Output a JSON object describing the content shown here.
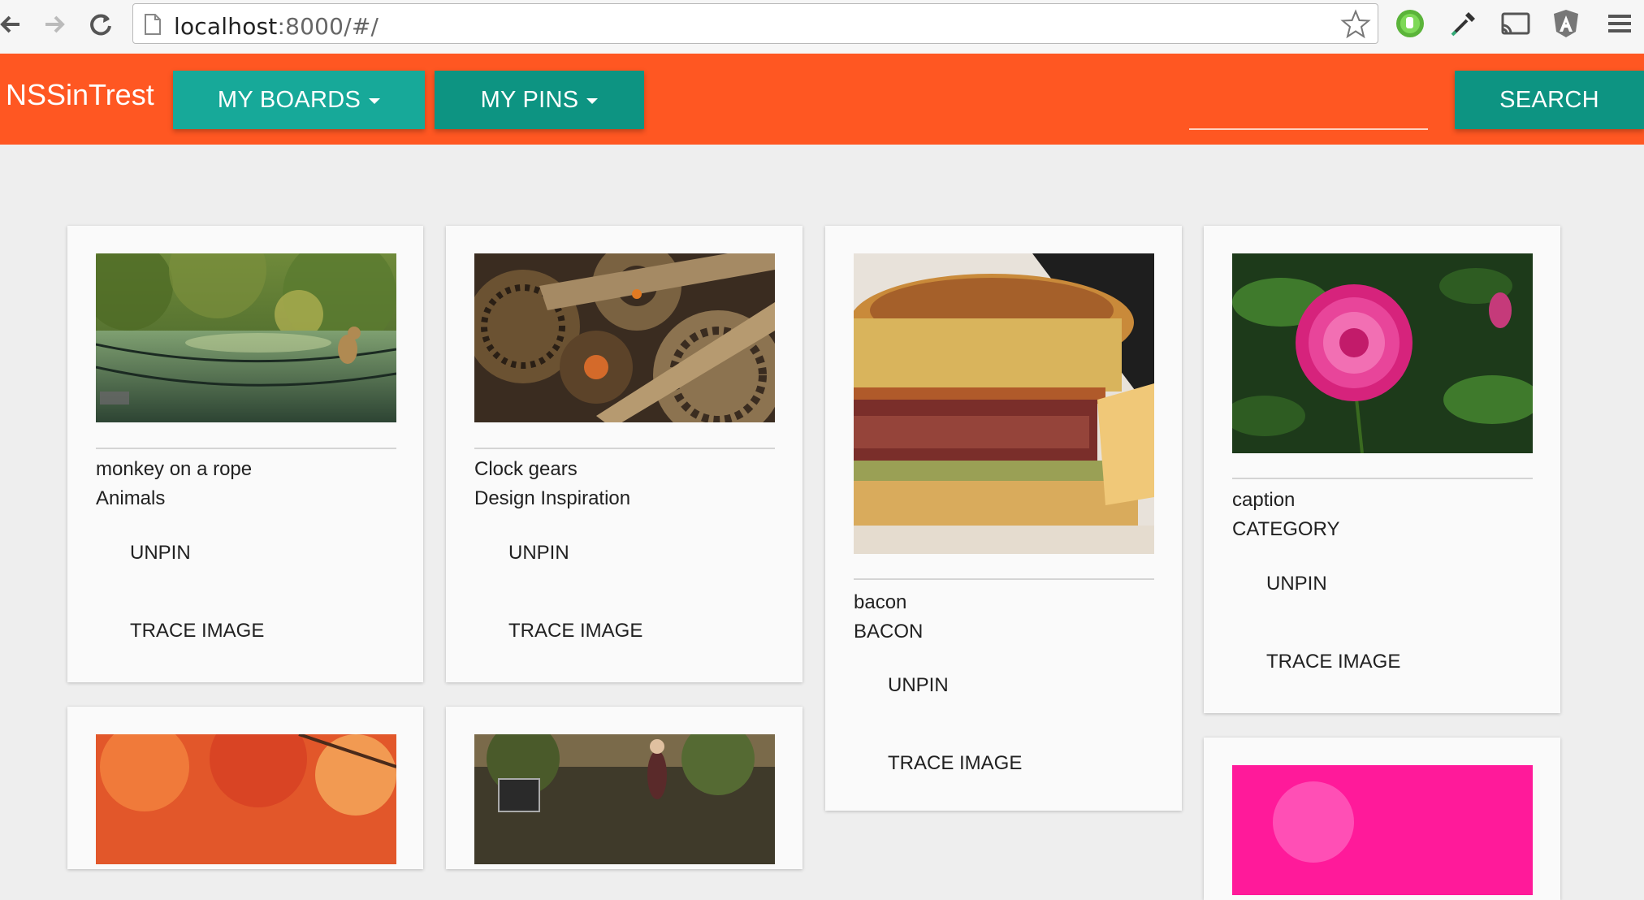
{
  "browser": {
    "url_host": "localhost",
    "url_rest": ":8000/#/"
  },
  "navbar": {
    "brand": "NSSinTrest",
    "my_boards": "MY BOARDS",
    "my_pins": "MY PINS",
    "search": "SEARCH",
    "search_value": ""
  },
  "colors": {
    "navbar": "#ff5722",
    "button_light": "#17a999",
    "button_dark": "#0d9482"
  },
  "cards": [
    {
      "caption": "monkey on a rope",
      "category": "Animals",
      "unpin": "UNPIN",
      "trace": "TRACE IMAGE",
      "image": "monkey-river-photo"
    },
    {
      "caption": "Clock gears",
      "category": "Design Inspiration",
      "unpin": "UNPIN",
      "trace": "TRACE IMAGE",
      "image": "clock-gears-photo"
    },
    {
      "caption": "bacon",
      "category": "BACON",
      "unpin": "UNPIN",
      "trace": "TRACE IMAGE",
      "image": "burger-photo"
    },
    {
      "caption": "caption",
      "category": "CATEGORY",
      "unpin": "UNPIN",
      "trace": "TRACE IMAGE",
      "image": "pink-dahlia-photo"
    }
  ]
}
